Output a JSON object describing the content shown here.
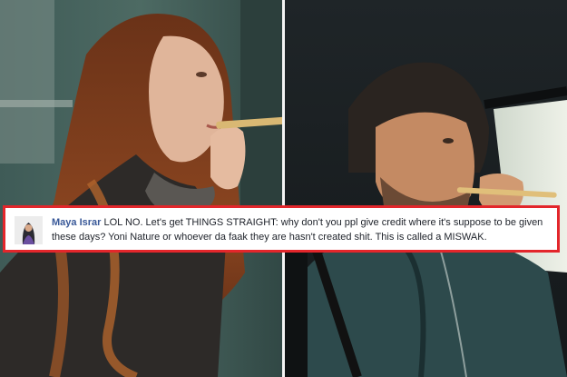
{
  "comment": {
    "author": "Maya Israr",
    "text": "LOL NO. Let's get THINGS STRAIGHT: why don't you ppl give credit where it's suppose to be given these days? Yoni Nature or whoever da faak they are hasn't created shit. This is called a MISWAK."
  },
  "colors": {
    "highlight_border": "#e3262b",
    "author_link": "#385898",
    "comment_text": "#1d2129"
  }
}
